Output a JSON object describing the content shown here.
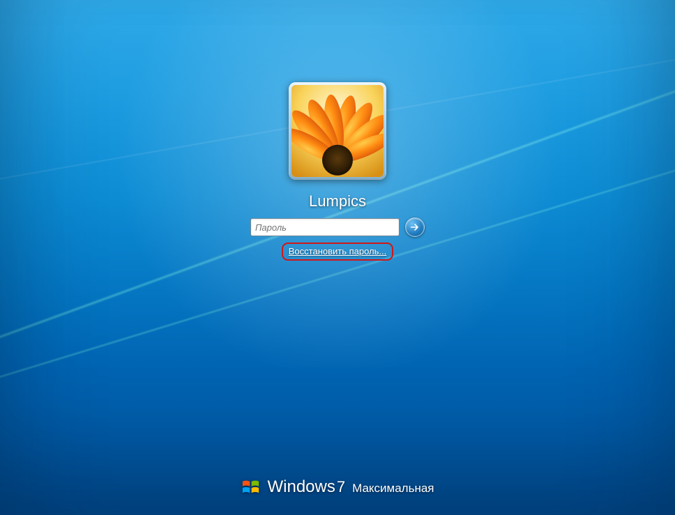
{
  "user": {
    "name": "Lumpics",
    "password_placeholder": "Пароль",
    "reset_link_label": "Восстановить пароль..."
  },
  "branding": {
    "product": "Windows",
    "version": "7",
    "edition": "Максимальная"
  },
  "icons": {
    "submit": "arrow-right-icon",
    "logo": "windows-logo-icon",
    "avatar": "orange-flower-avatar"
  },
  "colors": {
    "highlight_ring": "#d01717",
    "link": "#ffffff"
  }
}
